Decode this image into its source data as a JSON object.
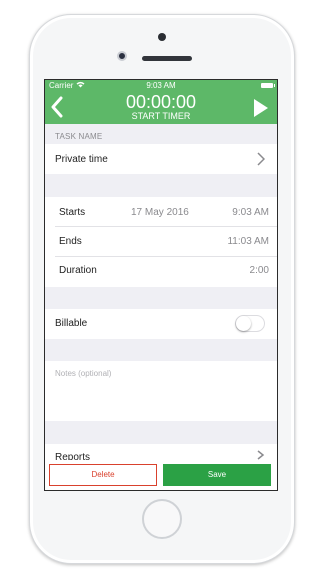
{
  "status_bar": {
    "carrier": "Carrier",
    "time": "9:03 AM"
  },
  "header": {
    "timer": "00:00:00",
    "start_label": "START TIMER"
  },
  "task": {
    "section_label": "TASK NAME",
    "name": "Private time"
  },
  "schedule": {
    "starts_label": "Starts",
    "starts_date": "17 May 2016",
    "starts_time": "9:03 AM",
    "ends_label": "Ends",
    "ends_time": "11:03 AM",
    "duration_label": "Duration",
    "duration_value": "2:00"
  },
  "billable": {
    "label": "Billable",
    "on": false
  },
  "notes": {
    "placeholder": "Notes (optional)"
  },
  "reports": {
    "label": "Reports"
  },
  "actions": {
    "delete_label": "Delete",
    "save_label": "Save"
  },
  "colors": {
    "header_green": "#5db868",
    "save_green": "#2ba145",
    "delete_red": "#d9412d"
  },
  "icons": {
    "back": "chevron-left-icon",
    "play": "play-icon",
    "disclosure": "chevron-right-icon",
    "wifi": "wifi-icon",
    "battery": "battery-icon"
  }
}
